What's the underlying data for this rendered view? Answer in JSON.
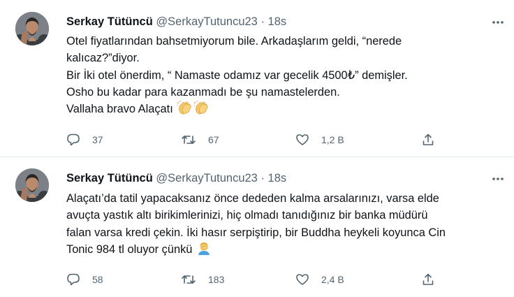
{
  "tweets": [
    {
      "author_name": "Serkay Tütüncü",
      "handle": "@SerkayTutuncu23",
      "separator": "·",
      "time": "18s",
      "lines": [
        "Otel fiyatlarından bahsetmiyorum bile. Arkadaşlarım geldi, “nerede",
        "kalıcaz?”diyor.",
        "Bir İki otel önerdim, “ Namaste odamız var gecelik 4500₺” demişler.",
        "Osho bu kadar para kazanmadı be şu namastelerden.",
        "Vallaha bravo Alaçatı"
      ],
      "emoji_icons": [
        "clapping-hands-icon",
        "clapping-hands-icon"
      ],
      "replies": "37",
      "retweets": "67",
      "likes": "1,2 B"
    },
    {
      "author_name": "Serkay Tütüncü",
      "handle": "@SerkayTutuncu23",
      "separator": "·",
      "time": "18s",
      "lines": [
        "Alaçatı’da tatil yapacaksanız önce dededen kalma arsalarınızı, varsa elde",
        "avuçta yastık altı birikimlerinizi, hiç olmadı tanıdığınız bir banka müdürü",
        "falan varsa kredi çekin. İki hasır serpiştirip, bir Buddha heykeli koyunca Cin",
        "Tonic 984 tl oluyor çünkü"
      ],
      "emoji_icons": [
        "man-facepalming-icon"
      ],
      "replies": "58",
      "retweets": "183",
      "likes": "2,4 B"
    }
  ],
  "colors": {
    "text": "#0f1419",
    "secondary": "#536471",
    "divider": "#e1e8ed",
    "emoji_skin": "#f5c76a"
  }
}
